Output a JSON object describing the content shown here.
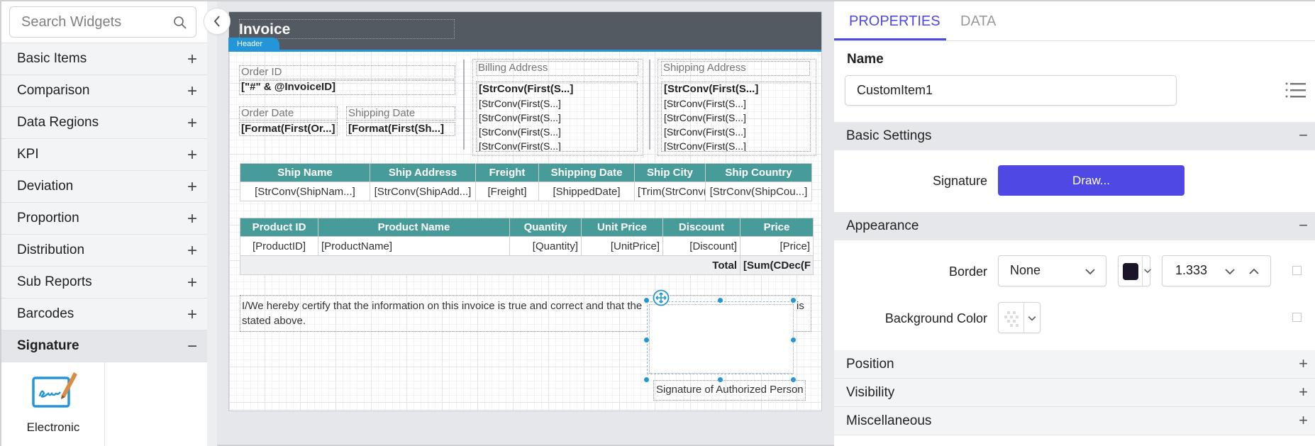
{
  "left_panel": {
    "search_placeholder": "Search Widgets",
    "categories": [
      {
        "label": "Basic Items",
        "expanded": false
      },
      {
        "label": "Comparison",
        "expanded": false
      },
      {
        "label": "Data Regions",
        "expanded": false
      },
      {
        "label": "KPI",
        "expanded": false
      },
      {
        "label": "Deviation",
        "expanded": false
      },
      {
        "label": "Proportion",
        "expanded": false
      },
      {
        "label": "Distribution",
        "expanded": false
      },
      {
        "label": "Sub Reports",
        "expanded": false
      },
      {
        "label": "Barcodes",
        "expanded": false
      },
      {
        "label": "Signature",
        "expanded": true
      }
    ],
    "expand_sign": "+",
    "collapse_sign": "−",
    "signature_widgets": [
      {
        "label": "Electronic",
        "icon": "electronic-signature-icon"
      }
    ]
  },
  "canvas": {
    "header": {
      "title": "Invoice",
      "band_label": "Header"
    },
    "order_id_label": "Order ID",
    "order_id_value": "[\"#\" & @InvoiceID]",
    "order_date_label": "Order Date",
    "order_date_value": "[Format(First(Or...]",
    "shipping_date_label": "Shipping Date",
    "shipping_date_value": "[Format(First(Sh...]",
    "billing_address": {
      "label": "Billing Address",
      "lines": [
        "[StrConv(First(S...]",
        "[StrConv(First(S...]",
        "[StrConv(First(S...]",
        "[StrConv(First(S...]",
        "[StrConv(First(S...]"
      ]
    },
    "shipping_address": {
      "label": "Shipping Address",
      "lines": [
        "[StrConv(First(S...]",
        "[StrConv(First(S...]",
        "[StrConv(First(S...]",
        "[StrConv(First(S...]",
        "[StrConv(First(S...]"
      ]
    },
    "ship_table": {
      "headers": [
        "Ship Name",
        "Ship Address",
        "Freight",
        "Shipping Date",
        "Ship City",
        "Ship Country"
      ],
      "row": [
        "[StrConv(ShipNam...]",
        "[StrConv(ShipAdd...]",
        "[Freight]",
        "[ShippedDate]",
        "[Trim(StrConv(",
        "[StrConv(ShipCou...]"
      ]
    },
    "product_table": {
      "headers": [
        "Product ID",
        "Product Name",
        "Quantity",
        "Unit Price",
        "Discount",
        "Price"
      ],
      "row": [
        "[ProductID]",
        "[ProductName]",
        "[Quantity]",
        "[UnitPrice]",
        "[Discount]",
        "[Price]"
      ],
      "total_label": "Total",
      "total_value": "[Sum(CDec(F"
    },
    "certification_text_1": "I/We hereby certify that the information on this invoice is true and correct and that the",
    "certification_text_tail": "is",
    "certification_text_2": "stated above.",
    "signature_caption": "Signature of Authorized Person"
  },
  "right_panel": {
    "tabs": [
      {
        "label": "PROPERTIES",
        "active": true
      },
      {
        "label": "DATA",
        "active": false
      }
    ],
    "name_label": "Name",
    "name_value": "CustomItem1",
    "sections": {
      "basic_settings": {
        "title": "Basic Settings",
        "expanded": true,
        "signature_label": "Signature",
        "draw_button": "Draw..."
      },
      "appearance": {
        "title": "Appearance",
        "expanded": true,
        "border_label": "Border",
        "border_style": "None",
        "border_color": "#1c1528",
        "border_width": "1.333",
        "background_label": "Background Color",
        "background_color": "transparent"
      },
      "position": {
        "title": "Position",
        "expanded": false
      },
      "visibility": {
        "title": "Visibility",
        "expanded": false
      },
      "miscellaneous": {
        "title": "Miscellaneous",
        "expanded": false
      }
    }
  },
  "colors": {
    "accent": "#4f47e5",
    "header_band": "#2495d9",
    "table_header": "#479c9a",
    "header_bg": "#535a62"
  }
}
